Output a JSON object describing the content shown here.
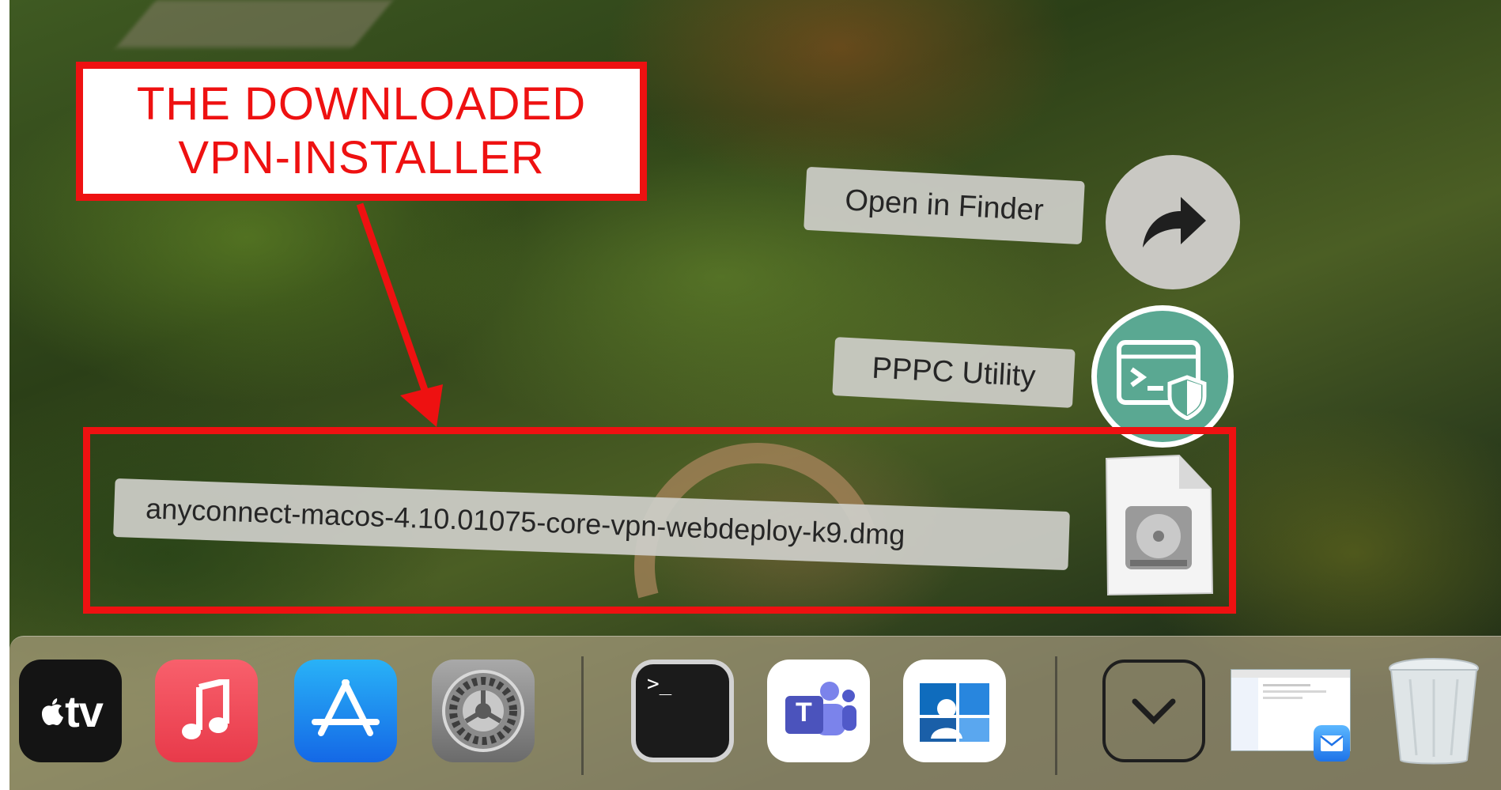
{
  "callout": {
    "line1": "THE DOWNLOADED",
    "line2": "VPN-INSTALLER"
  },
  "stack": {
    "items": [
      {
        "label": "Open in Finder",
        "icon": "share-arrow-icon"
      },
      {
        "label": "PPPC Utility",
        "icon": "terminal-shield-icon"
      },
      {
        "label": "anyconnect-macos-4.10.01075-core-vpn-webdeploy-k9.dmg",
        "icon": "disk-image-icon"
      }
    ]
  },
  "dock": {
    "apps": [
      {
        "name": "Apple TV",
        "icon": "apple-tv-icon",
        "glyph": "tv"
      },
      {
        "name": "Music",
        "icon": "music-note-icon"
      },
      {
        "name": "App Store",
        "icon": "app-store-icon"
      },
      {
        "name": "System Preferences",
        "icon": "gear-icon"
      },
      {
        "name": "Terminal",
        "icon": "terminal-icon",
        "glyph": ">_"
      },
      {
        "name": "Microsoft Teams",
        "icon": "teams-icon",
        "glyph": "T"
      },
      {
        "name": "Remote Desktop",
        "icon": "remote-desktop-icon"
      },
      {
        "name": "Downloads",
        "icon": "chevron-down-icon"
      },
      {
        "name": "Mail window",
        "icon": "mail-icon"
      },
      {
        "name": "Trash",
        "icon": "trash-icon"
      }
    ]
  },
  "colors": {
    "annotation_red": "#ee1111",
    "pill_bg": "#cdcdc8",
    "pppc_green": "#5aa892"
  }
}
